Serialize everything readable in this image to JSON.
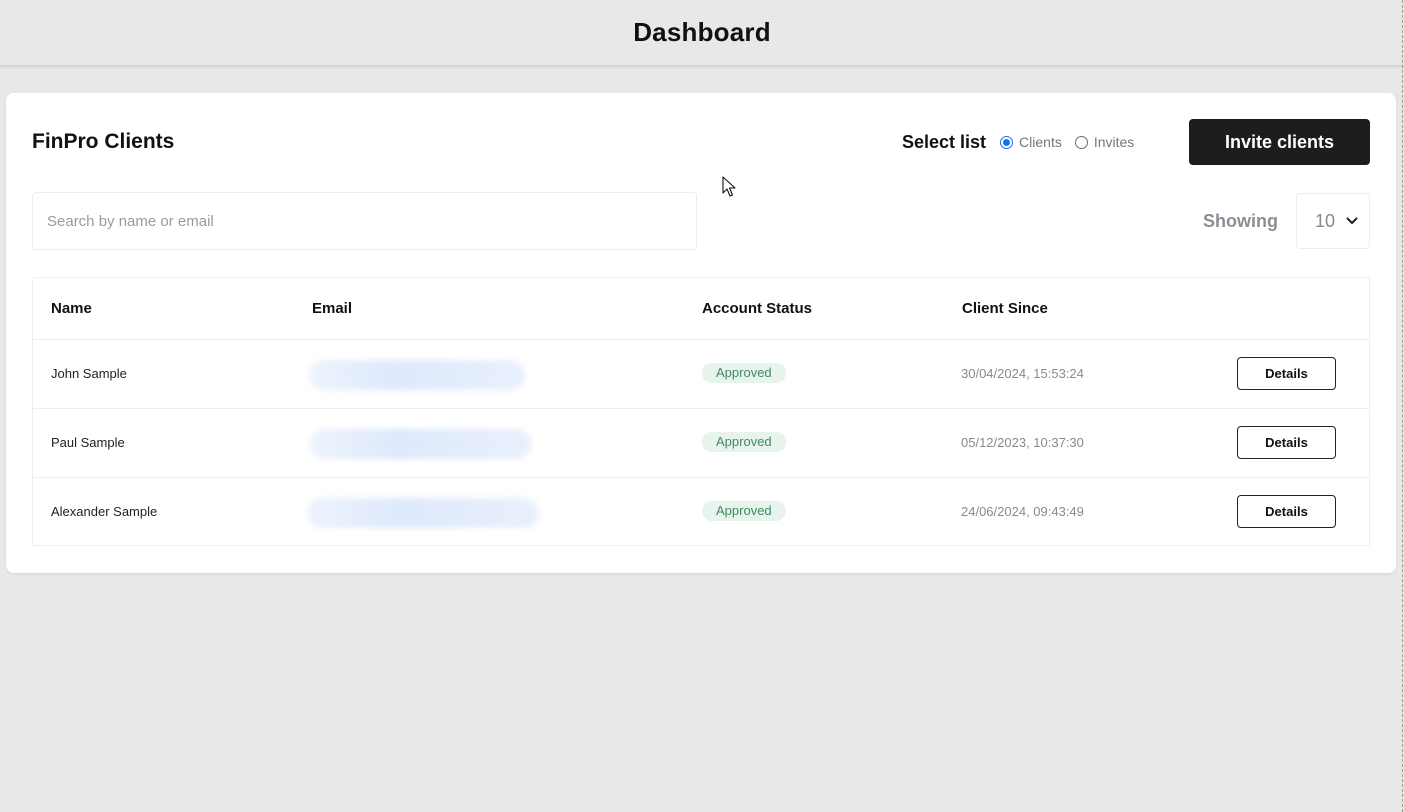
{
  "header": {
    "title": "Dashboard"
  },
  "card": {
    "title": "FinPro Clients",
    "select_list": {
      "label": "Select list",
      "options": [
        {
          "label": "Clients",
          "selected": true
        },
        {
          "label": "Invites",
          "selected": false
        }
      ]
    },
    "invite_button": "Invite clients",
    "search": {
      "placeholder": "Search by name or email",
      "value": ""
    },
    "showing": {
      "label": "Showing",
      "value": "10"
    }
  },
  "table": {
    "columns": [
      "Name",
      "Email",
      "Account Status",
      "Client Since"
    ],
    "rows": [
      {
        "name": "John Sample",
        "email": "",
        "status": "Approved",
        "since": "30/04/2024, 15:53:24",
        "action": "Details"
      },
      {
        "name": "Paul Sample",
        "email": "",
        "status": "Approved",
        "since": "05/12/2023, 10:37:30",
        "action": "Details"
      },
      {
        "name": "Alexander Sample",
        "email": "",
        "status": "Approved",
        "since": "24/06/2024, 09:43:49",
        "action": "Details"
      }
    ]
  },
  "colors": {
    "page_bg": "#e8e8e8",
    "primary_button": "#1c1d1f",
    "status_approved_text": "#3f8a62",
    "status_approved_bg": "#e9f3ee",
    "radio_accent": "#1a73e8"
  },
  "icons": [
    "chevron-down-icon",
    "mouse-cursor-icon"
  ]
}
